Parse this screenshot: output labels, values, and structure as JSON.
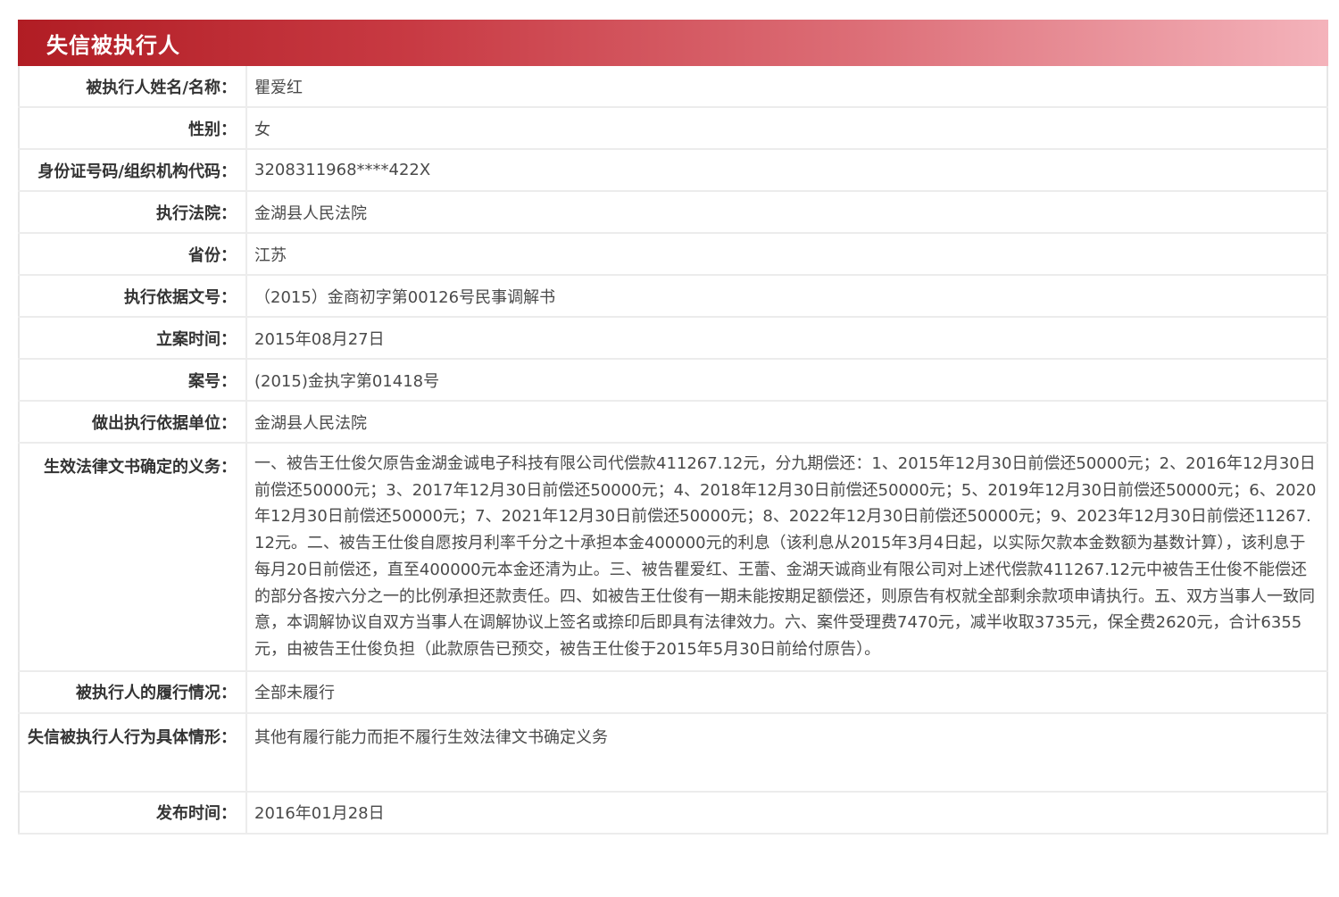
{
  "panel": {
    "title": "失信被执行人"
  },
  "rows": [
    {
      "label": "被执行人姓名/名称：",
      "value": "瞿爱红"
    },
    {
      "label": "性别：",
      "value": "女"
    },
    {
      "label": "身份证号码/组织机构代码：",
      "value": "3208311968****422X"
    },
    {
      "label": "执行法院：",
      "value": "金湖县人民法院"
    },
    {
      "label": "省份：",
      "value": "江苏"
    },
    {
      "label": "执行依据文号：",
      "value": "（2015）金商初字第00126号民事调解书"
    },
    {
      "label": "立案时间：",
      "value": "2015年08月27日"
    },
    {
      "label": "案号：",
      "value": "(2015)金执字第01418号"
    },
    {
      "label": "做出执行依据单位：",
      "value": "金湖县人民法院"
    },
    {
      "label": "生效法律文书确定的义务：",
      "value": "一、被告王仕俊欠原告金湖金诚电子科技有限公司代偿款411267.12元，分九期偿还：1、2015年12月30日前偿还50000元；2、2016年12月30日前偿还50000元；3、2017年12月30日前偿还50000元；4、2018年12月30日前偿还50000元；5、2019年12月30日前偿还50000元；6、2020年12月30日前偿还50000元；7、2021年12月30日前偿还50000元；8、2022年12月30日前偿还50000元；9、2023年12月30日前偿还11267.12元。二、被告王仕俊自愿按月利率千分之十承担本金400000元的利息（该利息从2015年3月4日起，以实际欠款本金数额为基数计算），该利息于每月20日前偿还，直至400000元本金还清为止。三、被告瞿爱红、王蕾、金湖天诚商业有限公司对上述代偿款411267.12元中被告王仕俊不能偿还的部分各按六分之一的比例承担还款责任。四、如被告王仕俊有一期未能按期足额偿还，则原告有权就全部剩余款项申请执行。五、双方当事人一致同意，本调解协议自双方当事人在调解协议上签名或捺印后即具有法律效力。六、案件受理费7470元，减半收取3735元，保全费2620元，合计6355元，由被告王仕俊负担（此款原告已预交，被告王仕俊于2015年5月30日前给付原告）。"
    },
    {
      "label": "被执行人的履行情况：",
      "value": "全部未履行"
    },
    {
      "label": "失信被执行人行为具体情形：",
      "value": "其他有履行能力而拒不履行生效法律文书确定义务"
    },
    {
      "label": "发布时间：",
      "value": "2016年01月28日"
    }
  ]
}
